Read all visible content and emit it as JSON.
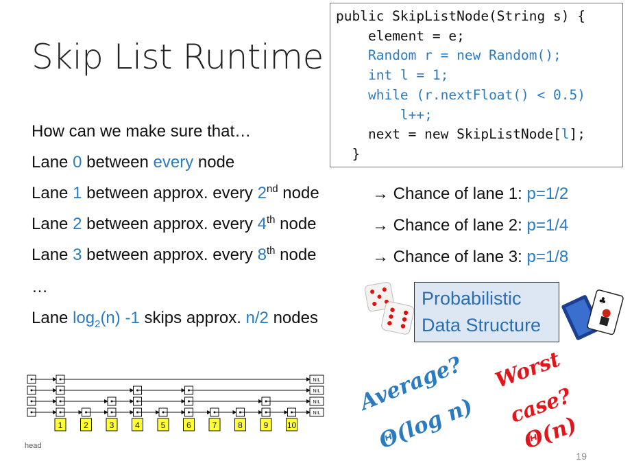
{
  "slide": {
    "title": "Skip List Runtime",
    "page_number": "19"
  },
  "code": {
    "lines": [
      {
        "text": "public SkipListNode(String s) {",
        "indent": 0,
        "color": "black"
      },
      {
        "text": "element = e;",
        "indent": 2,
        "color": "black"
      },
      {
        "text": "Random r = new Random();",
        "indent": 2,
        "color": "blue"
      },
      {
        "text": "int l = 1;",
        "indent": 2,
        "color": "blue"
      },
      {
        "text": "while (r.nextFloat() < 0.5)",
        "indent": 2,
        "color": "blue"
      },
      {
        "text": "l++;",
        "indent": 3,
        "color": "blue"
      },
      {
        "text_before": "next = new SkipListNode[",
        "text_blue": "l",
        "text_after": "];",
        "indent": 2,
        "color": "mixed"
      },
      {
        "text": "}",
        "indent": 1,
        "color": "black"
      }
    ]
  },
  "body": {
    "question": "How can we make sure that…",
    "lanes": [
      {
        "prefix": "Lane ",
        "num": "0",
        "middle": " between ",
        "blue_word": "every",
        "suffix": " node"
      },
      {
        "prefix": "Lane ",
        "num": "1",
        "middle": " between approx. every ",
        "ord": "2",
        "sup": "nd",
        "suffix": " node"
      },
      {
        "prefix": "Lane ",
        "num": "2",
        "middle": " between approx. every ",
        "ord": "4",
        "sup": "th",
        "suffix": " node"
      },
      {
        "prefix": "Lane ",
        "num": "3",
        "middle": " between approx. every ",
        "ord": "8",
        "sup": "th",
        "suffix": " node"
      }
    ],
    "ellipsis": "…",
    "last_lane": {
      "prefix": "Lane ",
      "log": "log",
      "sub": "2",
      "arg": "(n)",
      "minus": " -1",
      "mid": " skips approx. ",
      "half": "n/2",
      "suffix": " nodes"
    }
  },
  "chances": [
    {
      "label": "→ Chance of lane 1:",
      "p": "p=1/2"
    },
    {
      "label": "→ Chance of lane 2:",
      "p": "p=1/4"
    },
    {
      "label": "→ Chance of lane 3:",
      "p": "p=1/8"
    }
  ],
  "prob_box": {
    "line1": "Probabilistic",
    "line2": "Data Structure"
  },
  "average": {
    "line1": "Average?",
    "line2": "Θ(log n)"
  },
  "worst": {
    "line1": "Worst",
    "line2": "case?",
    "line3": "Θ(n)"
  },
  "skiplist": {
    "head_label": "head",
    "nil_label": "NIL",
    "nodes": [
      "1",
      "2",
      "3",
      "4",
      "5",
      "6",
      "7",
      "8",
      "9",
      "10"
    ],
    "heights": [
      4,
      1,
      2,
      3,
      1,
      3,
      1,
      1,
      2,
      1
    ]
  },
  "colors": {
    "accent_blue": "#2a7bc0",
    "red": "#e0161c",
    "node_yellow": "#ffff33",
    "box_fill": "#dce7f3"
  }
}
